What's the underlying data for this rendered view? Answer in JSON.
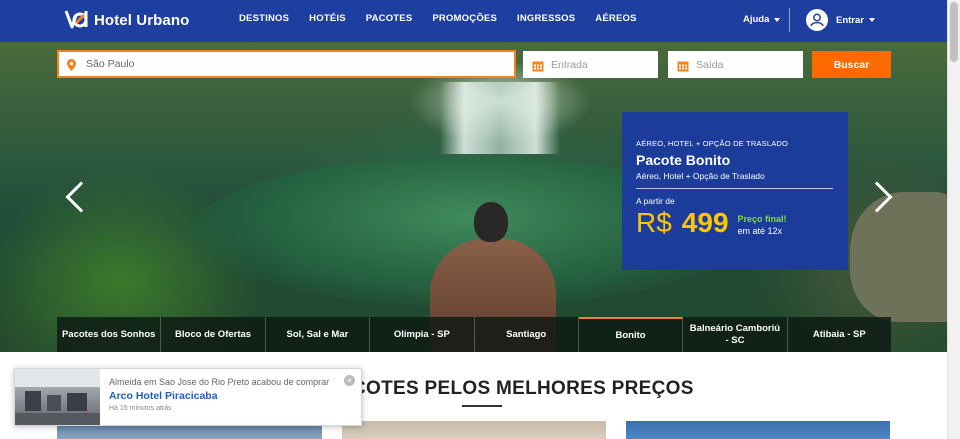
{
  "header": {
    "brand": "Hotel Urbano",
    "nav": [
      "DESTINOS",
      "HOTÉIS",
      "PACOTES",
      "PROMOÇÕES",
      "INGRESSOS",
      "AÉREOS"
    ],
    "help_label": "Ajuda",
    "login_label": "Entrar",
    "brand_color": "#1f3fa0",
    "accent_color": "#f5821f"
  },
  "search": {
    "destination_value": "São Paulo",
    "checkin_placeholder": "Entrada",
    "checkout_placeholder": "Saída",
    "button_label": "Buscar"
  },
  "promo": {
    "tag": "AÉREO, HOTEL + OPÇÃO DE TRASLADO",
    "title": "Pacote Bonito",
    "subtitle": "Aéreo, Hotel + Opção de Traslado",
    "from_label": "A partir de",
    "currency": "R$",
    "price": "499",
    "final_label": "Preço final!",
    "installments": "em até 12x"
  },
  "tabs": [
    {
      "label": "Pacotes dos Sonhos",
      "active": false
    },
    {
      "label": "Bloco de Ofertas",
      "active": false
    },
    {
      "label": "Sol, Sal e Mar",
      "active": false
    },
    {
      "label": "Olímpia - SP",
      "active": false
    },
    {
      "label": "Santiago",
      "active": false
    },
    {
      "label": "Bonito",
      "active": true
    },
    {
      "label": "Balneário Camboriú - SC",
      "active": false
    },
    {
      "label": "Atibaia - SP",
      "active": false
    }
  ],
  "section": {
    "title": "COTES PELOS MELHORES PREÇOS"
  },
  "notification": {
    "message": "Almeida em Sao Jose do Rio Preto acabou de comprar",
    "hotel": "Arco Hotel Piracicaba",
    "time": "Há 15 minutos atrás"
  }
}
